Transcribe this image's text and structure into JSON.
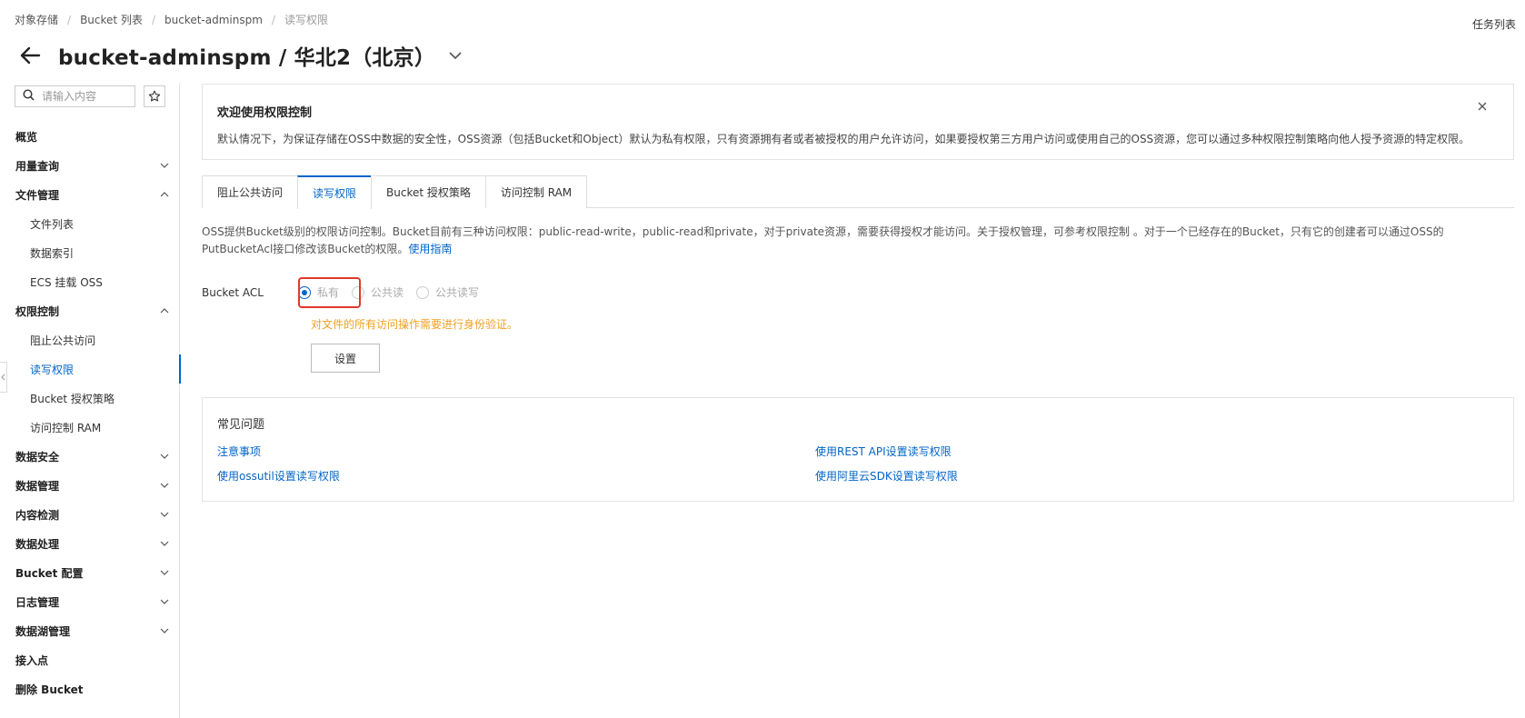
{
  "breadcrumb": {
    "items": [
      "对象存储",
      "Bucket 列表",
      "bucket-adminspm"
    ],
    "current": "读写权限"
  },
  "header": {
    "task_list": "任务列表",
    "title": "bucket-adminspm / 华北2（北京）"
  },
  "sidebar": {
    "search_placeholder": "请输入内容",
    "items": [
      {
        "label": "概览",
        "level": "top",
        "expandable": false
      },
      {
        "label": "用量查询",
        "level": "top",
        "expandable": true,
        "expanded": false
      },
      {
        "label": "文件管理",
        "level": "top",
        "expandable": true,
        "expanded": true
      },
      {
        "label": "文件列表",
        "level": "sub"
      },
      {
        "label": "数据索引",
        "level": "sub"
      },
      {
        "label": "ECS 挂载 OSS",
        "level": "sub"
      },
      {
        "label": "权限控制",
        "level": "top",
        "expandable": true,
        "expanded": true
      },
      {
        "label": "阻止公共访问",
        "level": "sub"
      },
      {
        "label": "读写权限",
        "level": "sub",
        "active": true
      },
      {
        "label": "Bucket 授权策略",
        "level": "sub"
      },
      {
        "label": "访问控制 RAM",
        "level": "sub"
      },
      {
        "label": "数据安全",
        "level": "top",
        "expandable": true,
        "expanded": false
      },
      {
        "label": "数据管理",
        "level": "top",
        "expandable": true,
        "expanded": false
      },
      {
        "label": "内容检测",
        "level": "top",
        "expandable": true,
        "expanded": false
      },
      {
        "label": "数据处理",
        "level": "top",
        "expandable": true,
        "expanded": false
      },
      {
        "label": "Bucket 配置",
        "level": "top",
        "expandable": true,
        "expanded": false
      },
      {
        "label": "日志管理",
        "level": "top",
        "expandable": true,
        "expanded": false
      },
      {
        "label": "数据湖管理",
        "level": "top",
        "expandable": true,
        "expanded": false
      },
      {
        "label": "接入点",
        "level": "top",
        "expandable": false
      },
      {
        "label": "删除 Bucket",
        "level": "top",
        "expandable": false
      }
    ]
  },
  "notice": {
    "title": "欢迎使用权限控制",
    "text": "默认情况下，为保证存储在OSS中数据的安全性，OSS资源（包括Bucket和Object）默认为私有权限，只有资源拥有者或者被授权的用户允许访问，如果要授权第三方用户访问或使用自己的OSS资源，您可以通过多种权限控制策略向他人授予资源的特定权限。"
  },
  "tabs": [
    {
      "label": "阻止公共访问",
      "active": false
    },
    {
      "label": "读写权限",
      "active": true
    },
    {
      "label": "Bucket 授权策略",
      "active": false
    },
    {
      "label": "访问控制 RAM",
      "active": false
    }
  ],
  "description": {
    "text": "OSS提供Bucket级别的权限访问控制。Bucket目前有三种访问权限：public-read-write，public-read和private，对于private资源，需要获得授权才能访问。关于授权管理，可参考权限控制 。对于一个已经存在的Bucket，只有它的创建者可以通过OSS的PutBucketAcl接口修改该Bucket的权限。",
    "link": "使用指南"
  },
  "acl": {
    "label": "Bucket ACL",
    "options": [
      {
        "label": "私有",
        "checked": true
      },
      {
        "label": "公共读",
        "checked": false
      },
      {
        "label": "公共读写",
        "checked": false
      }
    ],
    "hint": "对文件的所有访问操作需要进行身份验证。",
    "set_button": "设置"
  },
  "faq": {
    "title": "常见问题",
    "links": [
      "注意事项",
      "使用REST API设置读写权限",
      "使用ossutil设置读写权限",
      "使用阿里云SDK设置读写权限"
    ]
  },
  "colors": {
    "accent": "#0064c8",
    "warning_text": "#f0a020",
    "highlight_border": "#e0392b"
  }
}
